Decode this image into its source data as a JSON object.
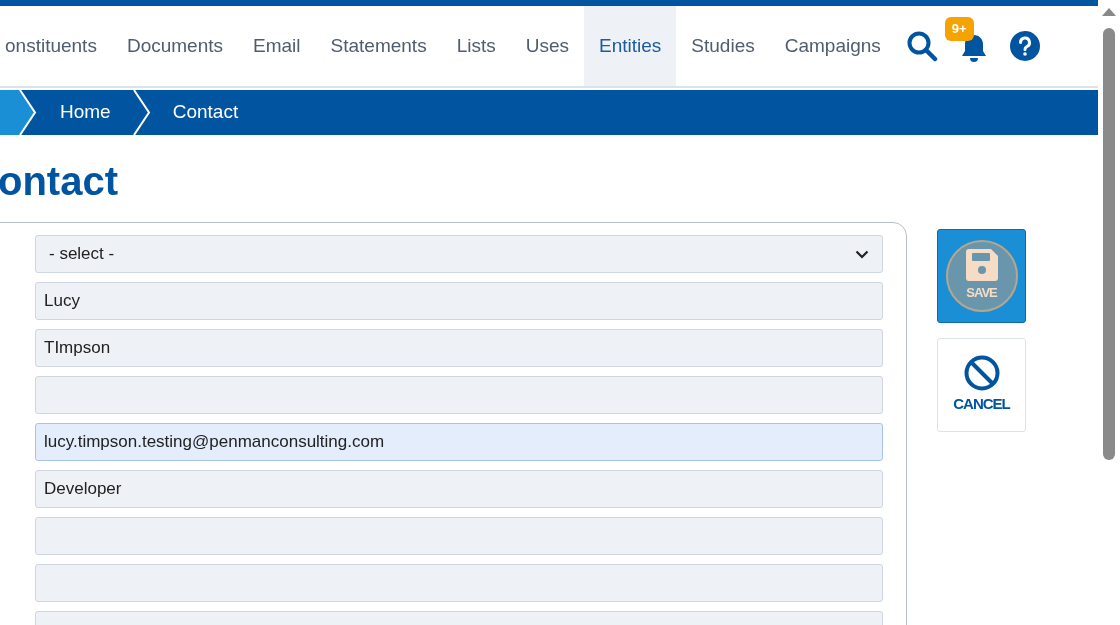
{
  "nav": {
    "items": [
      {
        "label": "onstituents",
        "selected": false
      },
      {
        "label": "Documents",
        "selected": false
      },
      {
        "label": "Email",
        "selected": false
      },
      {
        "label": "Statements",
        "selected": false
      },
      {
        "label": "Lists",
        "selected": false
      },
      {
        "label": "Uses",
        "selected": false
      },
      {
        "label": "Entities",
        "selected": true
      },
      {
        "label": "Studies",
        "selected": false
      },
      {
        "label": "Campaigns",
        "selected": false
      }
    ],
    "notification_badge": "9+"
  },
  "breadcrumb": [
    {
      "label": "Home"
    },
    {
      "label": "Contact"
    }
  ],
  "page_title": "ontact",
  "form": {
    "fields": [
      {
        "kind": "select",
        "value": "- select -",
        "focused": false
      },
      {
        "kind": "text",
        "value": "Lucy",
        "focused": false
      },
      {
        "kind": "text",
        "value": "TImpson",
        "focused": false
      },
      {
        "kind": "text",
        "focused": false
      },
      {
        "kind": "text",
        "value": "lucy.timpson.testing@penmanconsulting.com",
        "focused": true
      },
      {
        "kind": "text",
        "value": "Developer",
        "focused": false
      },
      {
        "kind": "text",
        "focused": false
      },
      {
        "kind": "text",
        "focused": false
      },
      {
        "kind": "text",
        "focused": false
      }
    ]
  },
  "actions": {
    "save": "SAVE",
    "cancel": "CANCEL"
  }
}
